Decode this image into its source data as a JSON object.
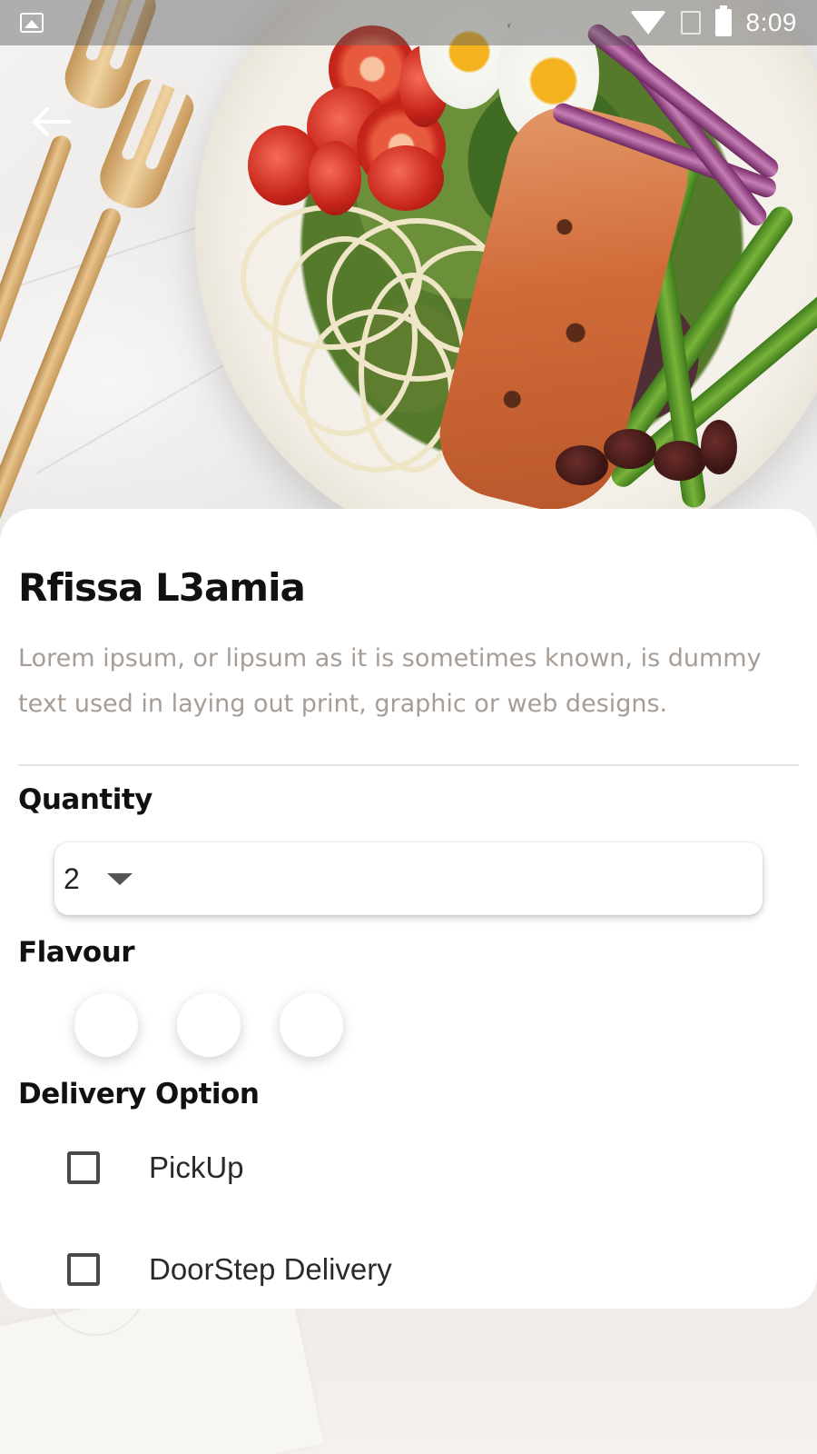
{
  "status_bar": {
    "time": "8:09",
    "icons": [
      "image-icon",
      "wifi-icon",
      "sim-off-icon",
      "battery-charging-icon"
    ]
  },
  "header": {
    "back_icon": "arrow-left-icon"
  },
  "product": {
    "title": "Rfissa L3amia",
    "description": "Lorem ipsum, or lipsum as it is sometimes known, is dummy text used in laying out print, graphic or web designs."
  },
  "quantity": {
    "label": "Quantity",
    "selected": "2",
    "dropdown_icon": "caret-down-icon"
  },
  "flavour": {
    "label": "Flavour",
    "swatches": [
      "#ffffff",
      "#ffffff",
      "#ffffff"
    ]
  },
  "delivery": {
    "label": "Delivery Option",
    "options": [
      {
        "label": "PickUp",
        "checked": false
      },
      {
        "label": "DoorStep Delivery",
        "checked": false
      }
    ]
  }
}
